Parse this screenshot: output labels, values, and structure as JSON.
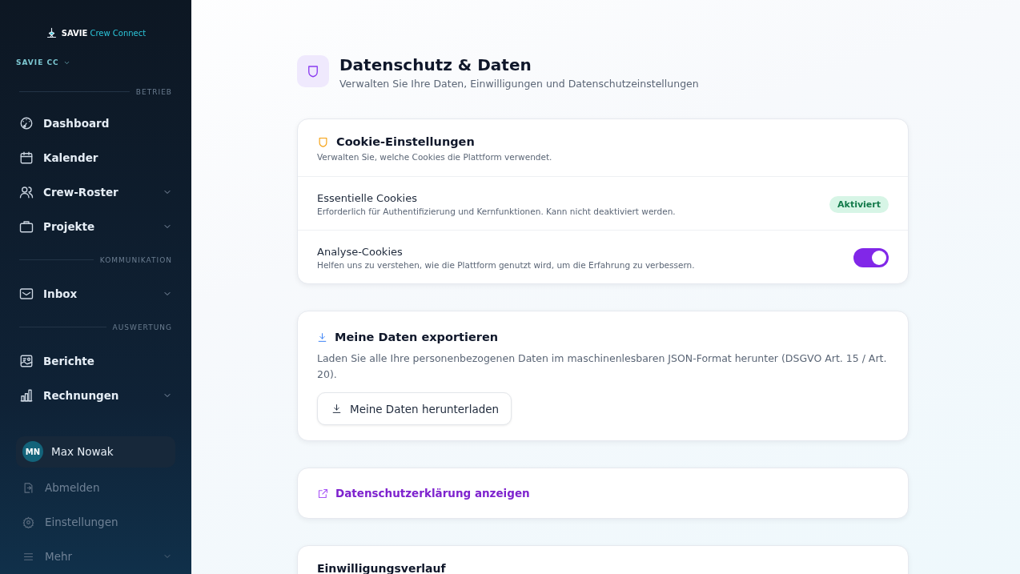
{
  "sidebar": {
    "logo": {
      "brand": "SAVIE",
      "product": "Crew Connect"
    },
    "workspace": "SAVIE CC",
    "sections": [
      {
        "label": "BETRIEB",
        "items": [
          {
            "label": "Dashboard",
            "expandable": false
          },
          {
            "label": "Kalender",
            "expandable": false
          },
          {
            "label": "Crew-Roster",
            "expandable": true
          },
          {
            "label": "Projekte",
            "expandable": true
          }
        ]
      },
      {
        "label": "KOMMUNIKATION",
        "items": [
          {
            "label": "Inbox",
            "expandable": true
          }
        ]
      },
      {
        "label": "AUSWERTUNG",
        "items": [
          {
            "label": "Berichte",
            "expandable": false
          },
          {
            "label": "Rechnungen",
            "expandable": true
          }
        ]
      }
    ],
    "user": {
      "initials": "MN",
      "name": "Max Nowak"
    },
    "footer_items": [
      {
        "label": "Abmelden",
        "expandable": false
      },
      {
        "label": "Einstellungen",
        "expandable": false
      },
      {
        "label": "Mehr",
        "expandable": true
      }
    ]
  },
  "page": {
    "title": "Datenschutz & Daten",
    "subtitle": "Verwalten Sie Ihre Daten, Einwilligungen und Datenschutzeinstellungen"
  },
  "cookie_card": {
    "title": "Cookie-Einstellungen",
    "description": "Verwalten Sie, welche Cookies die Plattform verwendet.",
    "rows": [
      {
        "kind": "badge",
        "title": "Essentielle Cookies",
        "description": "Erforderlich für Authentifizierung und Kernfunktionen. Kann nicht deaktiviert werden.",
        "badge": "Aktiviert"
      },
      {
        "kind": "toggle",
        "title": "Analyse-Cookies",
        "description": "Helfen uns zu verstehen, wie die Plattform genutzt wird, um die Erfahrung zu verbessern.",
        "on": true
      }
    ]
  },
  "export_card": {
    "title": "Meine Daten exportieren",
    "description": "Laden Sie alle Ihre personenbezogenen Daten im maschinenlesbaren JSON-Format herunter (DSGVO Art. 15 / Art. 20).",
    "button": "Meine Daten herunterladen"
  },
  "privacy_link": "Datenschutzerklärung anzeigen",
  "consent_card": {
    "title": "Einwilligungsverlauf"
  }
}
